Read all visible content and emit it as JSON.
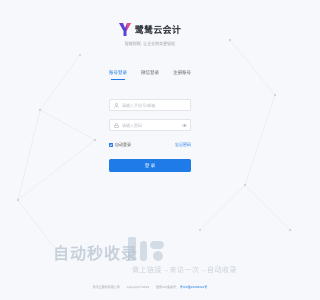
{
  "brand": {
    "name": "鹭鸶云会计",
    "slogan": "智能财税, 让企业财务更轻松"
  },
  "tabs": [
    {
      "label": "账号登录",
      "active": true
    },
    {
      "label": "微信登录",
      "active": false
    },
    {
      "label": "注册账号",
      "active": false
    }
  ],
  "form": {
    "account_placeholder": "请输入手机号/邮箱",
    "password_placeholder": "请输入密码",
    "remember_label": "自动登录",
    "forgot_label": "忘记密码",
    "login_label": "登 录"
  },
  "footer": {
    "company": "鹭鸶云服务有限公司",
    "copyright": "Copyright ©2019",
    "icp_prefix": "国家ICP备案号：",
    "icp_link": "粤ICP备19005021号"
  },
  "watermark": {
    "title": "自动秒收录",
    "subtitle": "做上链接→来访一次→自动收录"
  },
  "colors": {
    "accent": "#1e7be8",
    "background": "#f7f8fb",
    "watermark": "#b7c4d2"
  },
  "icons": [
    "brand-logo-icon",
    "user-icon",
    "lock-icon",
    "eye-icon",
    "checkbox-checked-icon"
  ]
}
